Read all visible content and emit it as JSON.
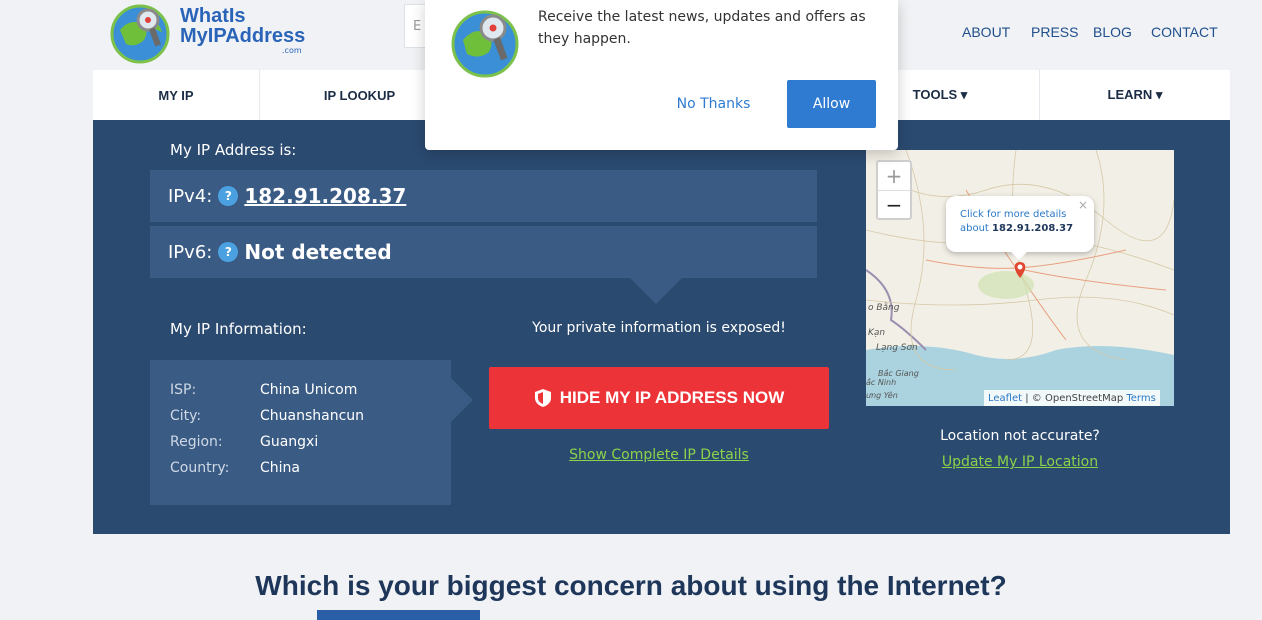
{
  "header": {
    "logo_line1": "WhatIs",
    "logo_line2": "MyIPAddress",
    "logo_suffix": ".com",
    "search_stub": "E",
    "links": [
      "ABOUT",
      "PRESS",
      "BLOG",
      "CONTACT"
    ]
  },
  "nav": {
    "items": [
      "MY IP",
      "IP LOOKUP",
      "TOOLS ▾",
      "LEARN ▾"
    ]
  },
  "panel": {
    "my_ip_label": "My IP Address is:",
    "ipv4_label": "IPv4:",
    "ipv4_value": "182.91.208.37",
    "ipv6_label": "IPv6:",
    "ipv6_value": "Not detected",
    "help_glyph": "?",
    "info_label": "My IP Information:",
    "exposed_text": "Your private information is exposed!",
    "info": [
      {
        "key": "ISP:",
        "value": "China Unicom"
      },
      {
        "key": "City:",
        "value": "Chuanshancun"
      },
      {
        "key": "Region:",
        "value": "Guangxi"
      },
      {
        "key": "Country:",
        "value": "China"
      }
    ],
    "hide_button": "HIDE MY IP ADDRESS NOW",
    "details_link": "Show Complete IP Details",
    "location_question": "Location not accurate?",
    "location_link": "Update My IP Location"
  },
  "map": {
    "zoom_in": "+",
    "zoom_out": "−",
    "popup_line1": "Click for more details",
    "popup_line2_prefix": "about",
    "popup_ip": "182.91.208.37",
    "popup_close": "×",
    "place_labels": [
      "o Bằng",
      "Kạn",
      "Lạng Sơn",
      "Bắc Giang",
      "ắc Ninh",
      "ưng Yên"
    ],
    "attribution_leaflet": "Leaflet",
    "attribution_mid": "| © OpenStreetMap",
    "attribution_terms": "Terms"
  },
  "concern_heading": "Which is your biggest concern about using the Internet?",
  "notification": {
    "message": "Receive the latest news, updates and offers as they happen.",
    "no_thanks": "No Thanks",
    "allow": "Allow"
  },
  "colors": {
    "panel": "#2b4a70",
    "accent_red": "#ec3338",
    "link_green": "#8bd34a",
    "allow_blue": "#2f7bd1"
  }
}
